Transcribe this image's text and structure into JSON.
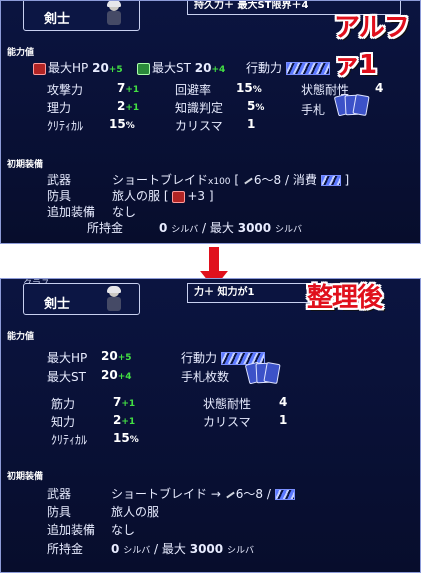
{
  "top_panel": {
    "class_name": "剣士",
    "callout": "持久力＋ 最大ST限界＋4",
    "handwriting": "アルファ1",
    "section_stats": "能力値",
    "max_hp_label": "最大HP",
    "max_hp_value": "20",
    "max_hp_bonus": "+5",
    "max_st_label": "最大ST",
    "max_st_value": "20",
    "max_st_bonus": "+4",
    "action_label": "行動力",
    "attack_label": "攻撃力",
    "attack_value": "7",
    "attack_bonus": "+1",
    "evasion_label": "回避率",
    "evasion_value": "15",
    "evasion_unit": "%",
    "status_res_label": "状態耐性",
    "status_res_value": "4",
    "intellect_label": "理力",
    "intellect_value": "2",
    "intellect_bonus": "+1",
    "knowledge_label": "知識判定",
    "knowledge_value": "5",
    "knowledge_unit": "%",
    "hand_label": "手札",
    "critical_label": "ｸﾘﾃｨｶﾙ",
    "critical_value": "15",
    "critical_unit": "%",
    "charisma_label": "カリスマ",
    "charisma_value": "1",
    "section_equip": "初期装備",
    "weapon_label": "武器",
    "weapon_value": "ショートブレイド",
    "weapon_qty": "x100",
    "weapon_open": "[",
    "weapon_dmg": "6～8 / 消費",
    "weapon_close": "]",
    "armor_label": "防具",
    "armor_value": "旅人の服",
    "armor_open": "[",
    "armor_bonus": "+3",
    "armor_close": "]",
    "extra_label": "追加装備",
    "extra_value": "なし",
    "money_label": "所持金",
    "money_value": "0",
    "money_unit": "シルバ",
    "money_sep": "/ 最大",
    "money_max": "3000",
    "money_max_unit": "シルバ"
  },
  "bottom_panel": {
    "class_label": "クラス",
    "class_name": "剣士",
    "callout": "力＋ 知力が1",
    "handwriting": "整理後",
    "section_stats": "能力値",
    "max_hp_label": "最大HP",
    "max_hp_value": "20",
    "max_hp_bonus": "+5",
    "max_st_label": "最大ST",
    "max_st_value": "20",
    "max_st_bonus": "+4",
    "action_label": "行動力",
    "hand_count_label": "手札枚数",
    "strength_label": "筋力",
    "strength_value": "7",
    "strength_bonus": "+1",
    "status_res_label": "状態耐性",
    "status_res_value": "4",
    "intellect_label": "知力",
    "intellect_value": "2",
    "intellect_bonus": "+1",
    "charisma_label": "カリスマ",
    "charisma_value": "1",
    "critical_label": "ｸﾘﾃｨｶﾙ",
    "critical_value": "15",
    "critical_unit": "%",
    "section_equip": "初期装備",
    "weapon_label": "武器",
    "weapon_value": "ショートブレイド",
    "weapon_arrow": "→",
    "weapon_dmg": "6～8 /",
    "armor_label": "防具",
    "armor_value": "旅人の服",
    "extra_label": "追加装備",
    "extra_value": "なし",
    "money_label": "所持金",
    "money_value": "0",
    "money_unit": "シルバ",
    "money_sep": "/ 最大",
    "money_max": "3000",
    "money_max_unit": "シルバ"
  },
  "colors": {
    "panel_bg": "#0b1440",
    "bonus_green": "#43e043",
    "annotation_red": "#e0101c"
  }
}
